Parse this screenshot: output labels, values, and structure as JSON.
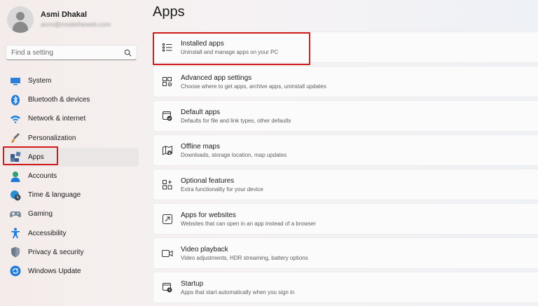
{
  "profile": {
    "name": "Asmi Dhakal",
    "email": "asmi@insidetheweb.com"
  },
  "search": {
    "placeholder": "Find a setting",
    "icon": "search-icon"
  },
  "nav": [
    {
      "label": "System",
      "icon": "system-icon",
      "color": "#2b7fd6"
    },
    {
      "label": "Bluetooth & devices",
      "icon": "bluetooth-icon",
      "color": "#1f7bd8"
    },
    {
      "label": "Network & internet",
      "icon": "wifi-icon",
      "color": "#1f84e0"
    },
    {
      "label": "Personalization",
      "icon": "brush-icon",
      "color": "#d98a3a"
    },
    {
      "label": "Apps",
      "icon": "apps-icon",
      "color": "#3b5b8c",
      "active": true
    },
    {
      "label": "Accounts",
      "icon": "accounts-icon",
      "color": "#2aa07a"
    },
    {
      "label": "Time & language",
      "icon": "globe-clock-icon",
      "color": "#2a8fd0"
    },
    {
      "label": "Gaming",
      "icon": "gamepad-icon",
      "color": "#7a8a9a"
    },
    {
      "label": "Accessibility",
      "icon": "accessibility-icon",
      "color": "#1f7bd8"
    },
    {
      "label": "Privacy & security",
      "icon": "shield-icon",
      "color": "#6d7a88"
    },
    {
      "label": "Windows Update",
      "icon": "update-icon",
      "color": "#1f7bd8"
    }
  ],
  "page": {
    "title": "Apps"
  },
  "cards": [
    {
      "title": "Installed apps",
      "subtitle": "Uninstall and manage apps on your PC",
      "icon": "list-icon"
    },
    {
      "title": "Advanced app settings",
      "subtitle": "Choose where to get apps, archive apps, uninstall updates",
      "icon": "app-settings-icon"
    },
    {
      "title": "Default apps",
      "subtitle": "Defaults for file and link types, other defaults",
      "icon": "default-apps-icon"
    },
    {
      "title": "Offline maps",
      "subtitle": "Downloads, storage location, map updates",
      "icon": "map-icon"
    },
    {
      "title": "Optional features",
      "subtitle": "Extra functionality for your device",
      "icon": "add-grid-icon"
    },
    {
      "title": "Apps for websites",
      "subtitle": "Websites that can open in an app instead of a browser",
      "icon": "open-external-icon"
    },
    {
      "title": "Video playback",
      "subtitle": "Video adjustments, HDR streaming, battery options",
      "icon": "video-icon"
    },
    {
      "title": "Startup",
      "subtitle": "Apps that start automatically when you sign in",
      "icon": "startup-icon"
    }
  ],
  "highlight_color": "#d11a1a"
}
